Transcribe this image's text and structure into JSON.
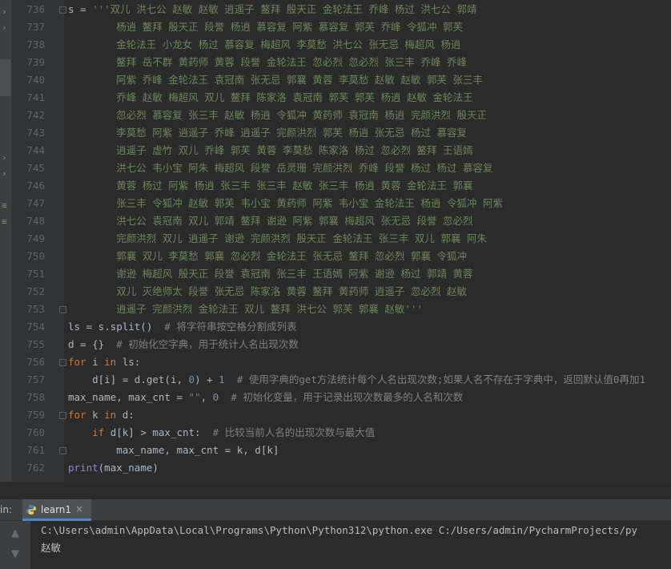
{
  "editor": {
    "lines": [
      {
        "num": "736",
        "indent": "",
        "parts": [
          [
            "t",
            "s = "
          ],
          [
            "s",
            "'''双儿 洪七公 赵敏 赵敏 逍遥子 鳌拜 殷天正 金轮法王 乔峰 杨过 洪七公 郭靖"
          ]
        ]
      },
      {
        "num": "737",
        "indent": "        ",
        "parts": [
          [
            "s",
            "杨逍 鳌拜 殷天正 段誉 杨逍 慕容复 阿紫 慕容复 郭芙 乔峰 令狐冲 郭芙"
          ]
        ]
      },
      {
        "num": "738",
        "indent": "        ",
        "parts": [
          [
            "s",
            "金轮法王 小龙女 杨过 慕容复 梅超风 李莫愁 洪七公 张无忌 梅超风 杨逍"
          ]
        ]
      },
      {
        "num": "739",
        "indent": "        ",
        "parts": [
          [
            "s",
            "鳌拜 岳不群 黄药师 黄蓉 段誉 金轮法王 忽必烈 忽必烈 张三丰 乔峰 乔峰"
          ]
        ]
      },
      {
        "num": "740",
        "indent": "        ",
        "parts": [
          [
            "s",
            "阿紫 乔峰 金轮法王 袁冠南 张无忌 郭襄 黄蓉 李莫愁 赵敏 赵敏 郭芙 张三丰"
          ]
        ]
      },
      {
        "num": "741",
        "indent": "        ",
        "parts": [
          [
            "s",
            "乔峰 赵敏 梅超风 双儿 鳌拜 陈家洛 袁冠南 郭芙 郭芙 杨逍 赵敏 金轮法王"
          ]
        ]
      },
      {
        "num": "742",
        "indent": "        ",
        "parts": [
          [
            "s",
            "忽必烈 慕容复 张三丰 赵敏 杨逍 令狐冲 黄药师 袁冠南 杨逍 完颜洪烈 殷天正"
          ]
        ]
      },
      {
        "num": "743",
        "indent": "        ",
        "parts": [
          [
            "s",
            "李莫愁 阿紫 逍遥子 乔峰 逍遥子 完颜洪烈 郭芙 杨逍 张无忌 杨过 慕容复"
          ]
        ]
      },
      {
        "num": "744",
        "indent": "        ",
        "parts": [
          [
            "s",
            "逍遥子 虚竹 双儿 乔峰 郭芙 黄蓉 李莫愁 陈家洛 杨过 忽必烈 鳌拜 王语嫣"
          ]
        ]
      },
      {
        "num": "745",
        "indent": "        ",
        "parts": [
          [
            "s",
            "洪七公 韦小宝 阿朱 梅超风 段誉 岳灵珊 完颜洪烈 乔峰 段誉 杨过 杨过 慕容复"
          ]
        ]
      },
      {
        "num": "746",
        "indent": "        ",
        "parts": [
          [
            "s",
            "黄蓉 杨过 阿紫 杨逍 张三丰 张三丰 赵敏 张三丰 杨逍 黄蓉 金轮法王 郭襄"
          ]
        ]
      },
      {
        "num": "747",
        "indent": "        ",
        "parts": [
          [
            "s",
            "张三丰 令狐冲 赵敏 郭芙 韦小宝 黄药师 阿紫 韦小宝 金轮法王 杨逍 令狐冲 阿紫"
          ]
        ]
      },
      {
        "num": "748",
        "indent": "        ",
        "parts": [
          [
            "s",
            "洪七公 袁冠南 双儿 郭靖 鳌拜 谢逊 阿紫 郭襄 梅超风 张无忌 段誉 忽必烈"
          ]
        ]
      },
      {
        "num": "749",
        "indent": "        ",
        "parts": [
          [
            "s",
            "完颜洪烈 双儿 逍遥子 谢逊 完颜洪烈 殷天正 金轮法王 张三丰 双儿 郭襄 阿朱"
          ]
        ]
      },
      {
        "num": "750",
        "indent": "        ",
        "parts": [
          [
            "s",
            "郭襄 双儿 李莫愁 郭襄 忽必烈 金轮法王 张无忌 鳌拜 忽必烈 郭襄 令狐冲"
          ]
        ]
      },
      {
        "num": "751",
        "indent": "        ",
        "parts": [
          [
            "s",
            "谢逊 梅超风 殷天正 段誉 袁冠南 张三丰 王语嫣 阿紫 谢逊 杨过 郭靖 黄蓉"
          ]
        ]
      },
      {
        "num": "752",
        "indent": "        ",
        "parts": [
          [
            "s",
            "双儿 灭绝师太 段誉 张无忌 陈家洛 黄蓉 鳌拜 黄药师 逍遥子 忽必烈 赵敏"
          ]
        ]
      },
      {
        "num": "753",
        "indent": "        ",
        "parts": [
          [
            "s",
            "逍遥子 完颜洪烈 金轮法王 双儿 鳌拜 洪七公 郭芙 郭襄 赵敏'''"
          ]
        ]
      },
      {
        "num": "754",
        "indent": "",
        "parts": [
          [
            "t",
            "ls = s.split()  "
          ],
          [
            "c",
            "# 将字符串按空格分割成列表"
          ]
        ]
      },
      {
        "num": "755",
        "indent": "",
        "parts": [
          [
            "t",
            "d = {}  "
          ],
          [
            "c",
            "# 初始化空字典，用于统计人名出现次数"
          ]
        ]
      },
      {
        "num": "756",
        "indent": "",
        "parts": [
          [
            "k",
            "for"
          ],
          [
            "t",
            " i "
          ],
          [
            "k",
            "in"
          ],
          [
            "t",
            " ls:"
          ]
        ]
      },
      {
        "num": "757",
        "indent": "    ",
        "parts": [
          [
            "t",
            "d[i] = d.get(i, "
          ],
          [
            "n",
            "0"
          ],
          [
            "t",
            ") + "
          ],
          [
            "n",
            "1"
          ],
          [
            "t",
            "  "
          ],
          [
            "c",
            "# 使用字典的get方法统计每个人名出现次数;如果人名不存在于字典中，返回默认值0再加1"
          ]
        ]
      },
      {
        "num": "758",
        "indent": "",
        "parts": [
          [
            "t",
            "max_name, max_cnt = "
          ],
          [
            "s",
            "\"\""
          ],
          [
            "t",
            ", "
          ],
          [
            "n",
            "0"
          ],
          [
            "t",
            "  "
          ],
          [
            "c",
            "# 初始化变量，用于记录出现次数最多的人名和次数"
          ]
        ]
      },
      {
        "num": "759",
        "indent": "",
        "parts": [
          [
            "k",
            "for"
          ],
          [
            "t",
            " k "
          ],
          [
            "k",
            "in"
          ],
          [
            "t",
            " d:"
          ]
        ]
      },
      {
        "num": "760",
        "indent": "    ",
        "parts": [
          [
            "k",
            "if"
          ],
          [
            "t",
            " d[k] > max_cnt:  "
          ],
          [
            "c",
            "# 比较当前人名的出现次数与最大值"
          ]
        ]
      },
      {
        "num": "761",
        "indent": "        ",
        "parts": [
          [
            "t",
            "max_name, max_cnt = k, d[k]"
          ]
        ]
      },
      {
        "num": "762",
        "indent": "",
        "parts": [
          [
            "f",
            "print"
          ],
          [
            "t",
            "(max_name)"
          ]
        ]
      }
    ]
  },
  "run_panel": {
    "label": "in:",
    "tab_label": "learn1",
    "tab_close": "×",
    "console": [
      "C:\\Users\\admin\\AppData\\Local\\Programs\\Python\\Python312\\python.exe C:/Users/admin/PycharmProjects/py",
      "赵敏"
    ]
  },
  "icons": {
    "python": "python-icon",
    "up": "▲",
    "down": "▼"
  },
  "colors": {
    "background": "#2b2b2b",
    "string": "#6a8759",
    "keyword": "#cc7832",
    "number": "#6897bb",
    "comment": "#808080",
    "builtin": "#8888c6",
    "text": "#a9b7c6"
  }
}
